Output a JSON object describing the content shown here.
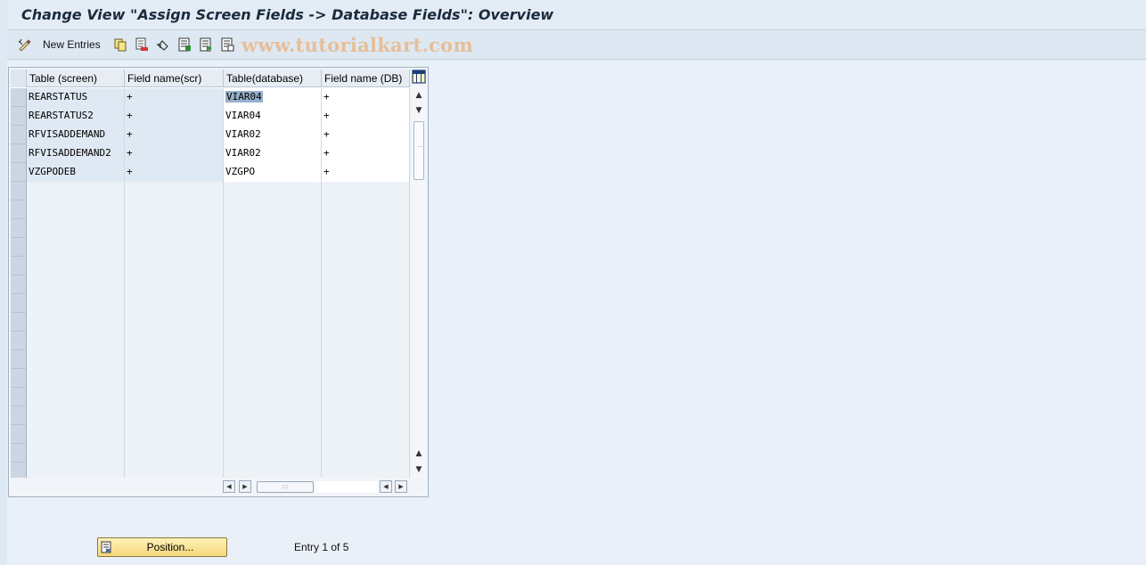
{
  "window": {
    "title": "Change View \"Assign Screen Fields -> Database Fields\": Overview"
  },
  "toolbar": {
    "new_entries_label": "New Entries",
    "icons": [
      "display-change-icon",
      "copy-icon",
      "delete-icon",
      "undo-icon",
      "select-all-icon",
      "select-block-icon",
      "deselect-all-icon"
    ],
    "watermark": "www.tutorialkart.com"
  },
  "table": {
    "columns": [
      "Table (screen)",
      "Field name(scr)",
      "Table(database)",
      "Field name (DB)"
    ],
    "rows": [
      {
        "table_screen": "REARSTATUS",
        "field_scr": "+",
        "table_db": "VIAR04",
        "field_db": "+"
      },
      {
        "table_screen": "REARSTATUS2",
        "field_scr": "+",
        "table_db": "VIAR04",
        "field_db": "+"
      },
      {
        "table_screen": "RFVISADDEMAND",
        "field_scr": "+",
        "table_db": "VIAR02",
        "field_db": "+"
      },
      {
        "table_screen": "RFVISADDEMAND2",
        "field_scr": "+",
        "table_db": "VIAR02",
        "field_db": "+"
      },
      {
        "table_screen": "VZGPODEB",
        "field_scr": "+",
        "table_db": "VZGPO",
        "field_db": "+"
      }
    ],
    "empty_rows": 16
  },
  "footer": {
    "position_label": "Position...",
    "entry_info": "Entry 1 of 5"
  },
  "colors": {
    "key_column_bg": "#dfe9f3",
    "selection_highlight": "#97b0cc",
    "button_bg": "#f4d77a"
  }
}
